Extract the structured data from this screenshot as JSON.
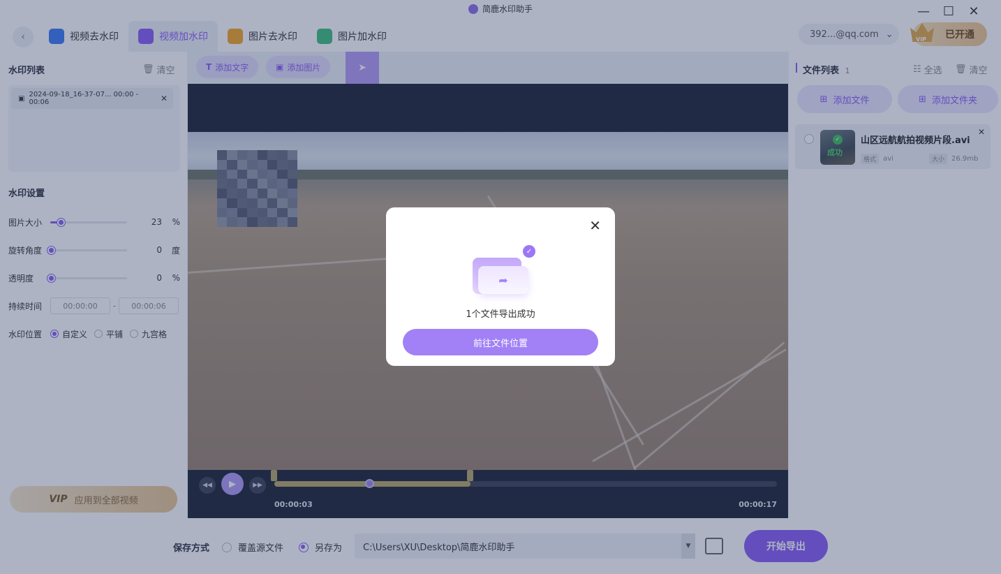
{
  "app": {
    "title": "简鹿水印助手"
  },
  "window": {
    "minimize": "—",
    "maximize": "☐",
    "close": "✕"
  },
  "tabs": [
    {
      "label": "视频去水印",
      "icon": "video-remove-icon",
      "color": "#3a7af5"
    },
    {
      "label": "视频加水印",
      "icon": "video-add-icon",
      "color": "#8a5cf5",
      "active": true
    },
    {
      "label": "图片去水印",
      "icon": "image-remove-icon",
      "color": "#f5a623"
    },
    {
      "label": "图片加水印",
      "icon": "image-add-icon",
      "color": "#3fbf7f"
    }
  ],
  "account": {
    "email": "392...@qq.com",
    "vip_label": "已开通",
    "vip_badge": "VIP"
  },
  "left": {
    "list_title": "水印列表",
    "clear_label": "清空",
    "item_text": "2024-09-18_16-37-07... 00:00 - 00:06",
    "settings_title": "水印设置",
    "size_label": "图片大小",
    "size_value": "23",
    "size_unit": "%",
    "size_fraction": 0.14,
    "rotate_label": "旋转角度",
    "rotate_value": "0",
    "rotate_unit": "度",
    "opacity_label": "透明度",
    "opacity_value": "0",
    "opacity_unit": "%",
    "duration_label": "持续时间",
    "duration_start": "00:00:00",
    "duration_sep": "-",
    "duration_end": "00:00:06",
    "position_label": "水印位置",
    "positions": [
      "自定义",
      "平铺",
      "九宫格"
    ],
    "apply_vip": "VIP",
    "apply_label": "应用到全部视频"
  },
  "toolbar": {
    "add_text": "添加文字",
    "add_image": "添加图片"
  },
  "player": {
    "current_time": "00:00:03",
    "total_time": "00:00:17",
    "progress_fraction": 0.19,
    "selection_end_fraction": 0.39
  },
  "right": {
    "title": "文件列表",
    "count": "1",
    "select_all": "全选",
    "clear_label": "清空",
    "add_file": "添加文件",
    "add_folder": "添加文件夹",
    "file": {
      "name": "山区远航航拍视频片段.avi",
      "status": "成功",
      "format_label": "格式",
      "format": "avi",
      "size_label": "大小",
      "size": "26.9mb"
    }
  },
  "bottom": {
    "save_label": "保存方式",
    "overwrite": "覆盖源文件",
    "save_as": "另存为",
    "path": "C:\\Users\\XU\\Desktop\\简鹿水印助手",
    "export": "开始导出"
  },
  "modal": {
    "message": "1个文件导出成功",
    "button": "前往文件位置"
  }
}
